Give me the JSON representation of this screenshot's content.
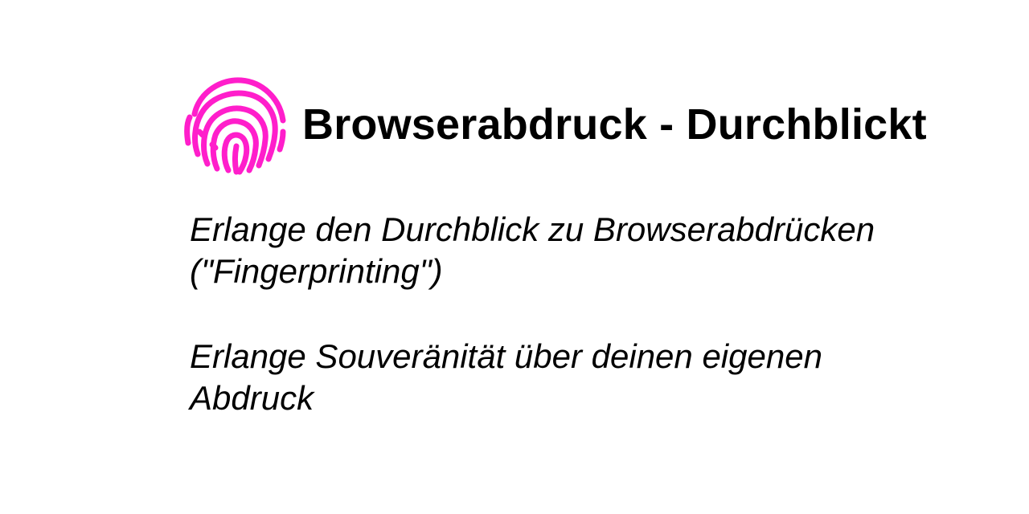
{
  "logo": {
    "icon": "fingerprint-icon",
    "color": "#ff1ecb"
  },
  "header": {
    "title": "Browserabdruck - Durchblickt"
  },
  "taglines": [
    {
      "line1": "Erlange den Durchblick zu Browserabdrücken",
      "line2": "(\"Fingerprinting\")"
    },
    {
      "line1": "Erlange Souveränität über deinen eigenen",
      "line2": "Abdruck"
    }
  ]
}
